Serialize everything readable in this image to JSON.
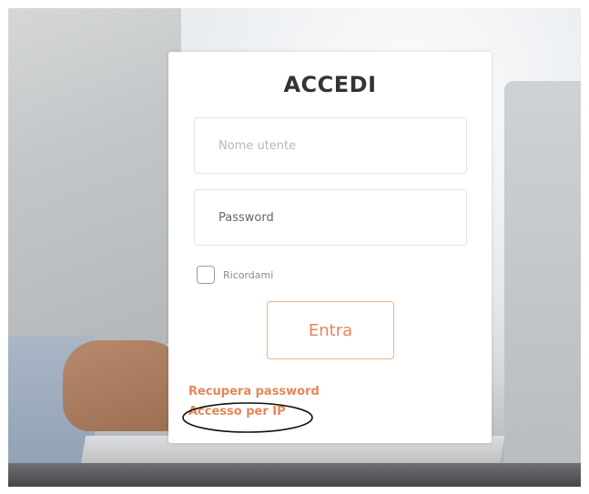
{
  "login": {
    "title": "ACCEDI",
    "username_placeholder": "Nome utente",
    "password_placeholder": "Password",
    "remember_label": "Ricordami",
    "remember_checked": false,
    "submit_label": "Entra",
    "recover_password_label": "Recupera password",
    "ip_access_label": "Accesso per IP"
  },
  "colors": {
    "accent": "#e3875a",
    "card": "#ffffff",
    "title": "#333333",
    "annotation": "#111111"
  }
}
